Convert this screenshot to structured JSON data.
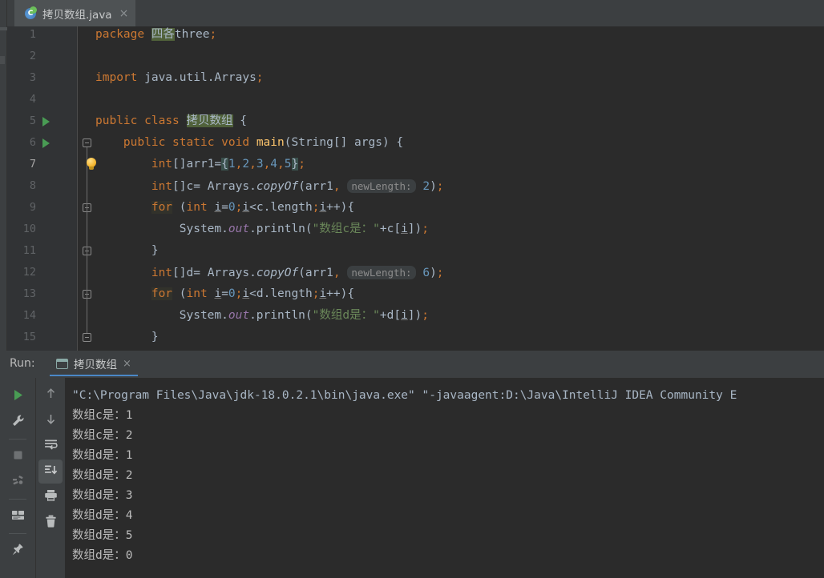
{
  "window": {
    "editor_tab": {
      "label": "拷贝数组.java",
      "icon": "java-class-icon",
      "close": "×",
      "icon_letter": "C"
    }
  },
  "editor": {
    "caret_line": 7,
    "lines": [
      {
        "no": "1",
        "tokens": [
          {
            "t": "package",
            "c": "kw"
          },
          {
            "t": " ",
            "c": "punct"
          },
          {
            "t": "四各",
            "c": "hl"
          },
          {
            "t": "three",
            "c": "ident"
          },
          {
            "t": ";",
            "c": "semi"
          }
        ]
      },
      {
        "no": "2",
        "tokens": []
      },
      {
        "no": "3",
        "tokens": [
          {
            "t": "import",
            "c": "kw"
          },
          {
            "t": " java.util.Arrays",
            "c": "ident"
          },
          {
            "t": ";",
            "c": "semi"
          }
        ]
      },
      {
        "no": "4",
        "tokens": []
      },
      {
        "no": "5",
        "tokens": [
          {
            "t": "public",
            "c": "kw"
          },
          {
            "t": " ",
            "c": "punct"
          },
          {
            "t": "class",
            "c": "kw"
          },
          {
            "t": " ",
            "c": "punct"
          },
          {
            "t": "拷贝数组",
            "c": "hl"
          },
          {
            "t": " {",
            "c": "punct"
          }
        ]
      },
      {
        "no": "6",
        "tokens": [
          {
            "t": "    ",
            "c": "punct"
          },
          {
            "t": "public",
            "c": "kw"
          },
          {
            "t": " ",
            "c": "punct"
          },
          {
            "t": "static",
            "c": "kw"
          },
          {
            "t": " ",
            "c": "punct"
          },
          {
            "t": "void",
            "c": "kw"
          },
          {
            "t": " ",
            "c": "punct"
          },
          {
            "t": "main",
            "c": "mth"
          },
          {
            "t": "(String[] args) {",
            "c": "punct"
          }
        ]
      },
      {
        "no": "7",
        "tokens": [
          {
            "t": "        ",
            "c": "punct"
          },
          {
            "t": "int",
            "c": "kw"
          },
          {
            "t": "[]arr1=",
            "c": "punct"
          },
          {
            "t": "{",
            "c": "chl"
          },
          {
            "t": "1",
            "c": "num"
          },
          {
            "t": ",",
            "c": "semi"
          },
          {
            "t": "2",
            "c": "num"
          },
          {
            "t": ",",
            "c": "semi"
          },
          {
            "t": "3",
            "c": "num"
          },
          {
            "t": ",",
            "c": "semi"
          },
          {
            "t": "4",
            "c": "num"
          },
          {
            "t": ",",
            "c": "semi"
          },
          {
            "t": "5",
            "c": "num"
          },
          {
            "t": "}",
            "c": "chl"
          },
          {
            "t": ";",
            "c": "semi"
          }
        ]
      },
      {
        "no": "8",
        "tokens": [
          {
            "t": "        ",
            "c": "punct"
          },
          {
            "t": "int",
            "c": "kw"
          },
          {
            "t": "[]c= Arrays.",
            "c": "punct"
          },
          {
            "t": "copyOf",
            "c": "stc"
          },
          {
            "t": "(arr1",
            "c": "punct"
          },
          {
            "t": ",",
            "c": "semi"
          },
          {
            "t": " ",
            "c": "punct"
          },
          {
            "t": "newLength:",
            "c": "hint"
          },
          {
            "t": " ",
            "c": "punct"
          },
          {
            "t": "2",
            "c": "num"
          },
          {
            "t": ")",
            "c": "punct"
          },
          {
            "t": ";",
            "c": "semi"
          }
        ]
      },
      {
        "no": "9",
        "tokens": [
          {
            "t": "        ",
            "c": "punct"
          },
          {
            "t": "for",
            "c": "kwb"
          },
          {
            "t": " (",
            "c": "punct"
          },
          {
            "t": "int",
            "c": "kw"
          },
          {
            "t": " ",
            "c": "punct"
          },
          {
            "t": "i",
            "c": "und"
          },
          {
            "t": "=",
            "c": "punct"
          },
          {
            "t": "0",
            "c": "num"
          },
          {
            "t": ";",
            "c": "semi"
          },
          {
            "t": "i",
            "c": "und"
          },
          {
            "t": "<c.length",
            "c": "punct"
          },
          {
            "t": ";",
            "c": "semi"
          },
          {
            "t": "i",
            "c": "und"
          },
          {
            "t": "++){",
            "c": "punct"
          }
        ]
      },
      {
        "no": "10",
        "tokens": [
          {
            "t": "            ",
            "c": "punct"
          },
          {
            "t": "System.",
            "c": "punct"
          },
          {
            "t": "out",
            "c": "fld"
          },
          {
            "t": ".println(",
            "c": "punct"
          },
          {
            "t": "\"数组c是：\"",
            "c": "str"
          },
          {
            "t": "+c[",
            "c": "punct"
          },
          {
            "t": "i",
            "c": "und"
          },
          {
            "t": "])",
            "c": "punct"
          },
          {
            "t": ";",
            "c": "semi"
          }
        ]
      },
      {
        "no": "11",
        "tokens": [
          {
            "t": "        }",
            "c": "punct"
          }
        ]
      },
      {
        "no": "12",
        "tokens": [
          {
            "t": "        ",
            "c": "punct"
          },
          {
            "t": "int",
            "c": "kw"
          },
          {
            "t": "[]d= Arrays.",
            "c": "punct"
          },
          {
            "t": "copyOf",
            "c": "stc"
          },
          {
            "t": "(arr1",
            "c": "punct"
          },
          {
            "t": ",",
            "c": "semi"
          },
          {
            "t": " ",
            "c": "punct"
          },
          {
            "t": "newLength:",
            "c": "hint"
          },
          {
            "t": " ",
            "c": "punct"
          },
          {
            "t": "6",
            "c": "num"
          },
          {
            "t": ")",
            "c": "punct"
          },
          {
            "t": ";",
            "c": "semi"
          }
        ]
      },
      {
        "no": "13",
        "tokens": [
          {
            "t": "        ",
            "c": "punct"
          },
          {
            "t": "for",
            "c": "kwb"
          },
          {
            "t": " (",
            "c": "punct"
          },
          {
            "t": "int",
            "c": "kw"
          },
          {
            "t": " ",
            "c": "punct"
          },
          {
            "t": "i",
            "c": "und"
          },
          {
            "t": "=",
            "c": "punct"
          },
          {
            "t": "0",
            "c": "num"
          },
          {
            "t": ";",
            "c": "semi"
          },
          {
            "t": "i",
            "c": "und"
          },
          {
            "t": "<d.length",
            "c": "punct"
          },
          {
            "t": ";",
            "c": "semi"
          },
          {
            "t": "i",
            "c": "und"
          },
          {
            "t": "++){",
            "c": "punct"
          }
        ]
      },
      {
        "no": "14",
        "tokens": [
          {
            "t": "            ",
            "c": "punct"
          },
          {
            "t": "System.",
            "c": "punct"
          },
          {
            "t": "out",
            "c": "fld"
          },
          {
            "t": ".println(",
            "c": "punct"
          },
          {
            "t": "\"数组d是：\"",
            "c": "str"
          },
          {
            "t": "+d[",
            "c": "punct"
          },
          {
            "t": "i",
            "c": "und"
          },
          {
            "t": "])",
            "c": "punct"
          },
          {
            "t": ";",
            "c": "semi"
          }
        ]
      },
      {
        "no": "15",
        "tokens": [
          {
            "t": "        }",
            "c": "punct"
          }
        ]
      }
    ]
  },
  "run_panel": {
    "label": "Run:",
    "tab": {
      "label": "拷贝数组",
      "icon": "console-icon",
      "close": "×"
    },
    "toolbar_left": [
      {
        "name": "rerun-button",
        "icon": "green-play-icon"
      },
      {
        "name": "edit-configuration-button",
        "icon": "wrench-icon"
      },
      {
        "name": "stop-button",
        "icon": "stop-square-icon"
      },
      {
        "name": "dump-threads-button",
        "icon": "threads-icon"
      },
      {
        "name": "layout-button",
        "icon": "layout-icon"
      },
      {
        "name": "pin-tab-button",
        "icon": "pin-icon"
      }
    ],
    "toolbar_right": [
      {
        "name": "up-button",
        "icon": "arrow-up-icon"
      },
      {
        "name": "down-button",
        "icon": "arrow-down-icon"
      },
      {
        "name": "soft-wrap-button",
        "icon": "soft-wrap-icon"
      },
      {
        "name": "scroll-to-end-button",
        "icon": "scroll-end-icon",
        "active": true
      },
      {
        "name": "print-button",
        "icon": "printer-icon"
      },
      {
        "name": "clear-all-button",
        "icon": "trash-icon"
      }
    ],
    "console": [
      {
        "text": "\"C:\\Program Files\\Java\\jdk-18.0.2.1\\bin\\java.exe\" \"-javaagent:D:\\Java\\IntelliJ IDEA Community E",
        "kind": "cmd"
      },
      {
        "text": "数组c是：1",
        "kind": "out"
      },
      {
        "text": "数组c是：2",
        "kind": "out"
      },
      {
        "text": "数组d是：1",
        "kind": "out"
      },
      {
        "text": "数组d是：2",
        "kind": "out"
      },
      {
        "text": "数组d是：3",
        "kind": "out"
      },
      {
        "text": "数组d是：4",
        "kind": "out"
      },
      {
        "text": "数组d是：5",
        "kind": "out"
      },
      {
        "text": "数组d是：0",
        "kind": "out"
      }
    ]
  },
  "colors": {
    "editor_bg": "#2b2b2b",
    "chrome_bg": "#3c3f41",
    "gutter_bg": "#313335",
    "keyword": "#cc7832",
    "string": "#6a8759",
    "number": "#6897bb",
    "method": "#ffc66d",
    "field": "#9876aa",
    "text": "#a9b7c6",
    "accent": "#4a88c7",
    "run_green": "#499c54"
  }
}
